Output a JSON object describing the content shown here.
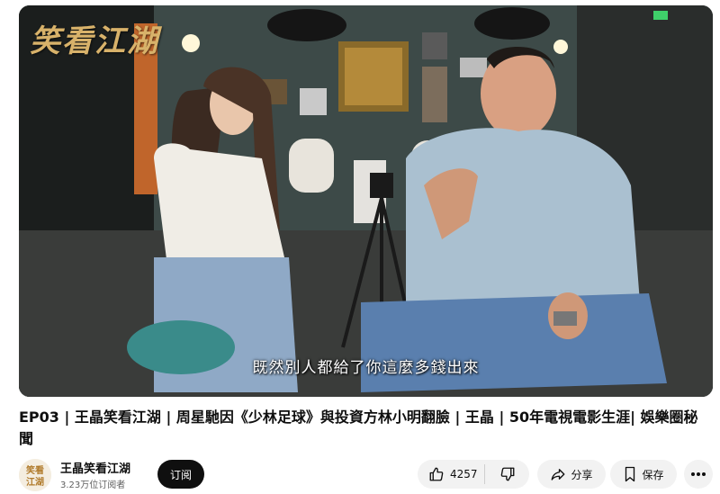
{
  "video": {
    "watermark": "笑看江湖",
    "subtitle": "既然別人都給了你這麼多錢出來"
  },
  "title": "EP03 | 王晶笑看江湖 | 周星馳因《少林足球》與投資方林小明翻臉 | 王晶 | 50年電視電影生涯| 娛樂圈秘聞",
  "channel": {
    "name": "王晶笑看江湖",
    "subscribers": "3.23万位订阅者",
    "avatar_text": "笑看江湖"
  },
  "actions": {
    "subscribe_label": "订阅",
    "like_count": "4257",
    "share_label": "分享",
    "save_label": "保存"
  },
  "colors": {
    "primary_text": "#0f0f0f",
    "secondary_text": "#606060",
    "pill_background": "#f2f2f2",
    "subscribe_background": "#0f0f0f",
    "watermark_gold": "#d8b26a"
  },
  "icons": {
    "like": "thumbs-up-icon",
    "dislike": "thumbs-down-icon",
    "share": "share-arrow-icon",
    "save": "bookmark-icon",
    "more": "more-horizontal-icon"
  }
}
